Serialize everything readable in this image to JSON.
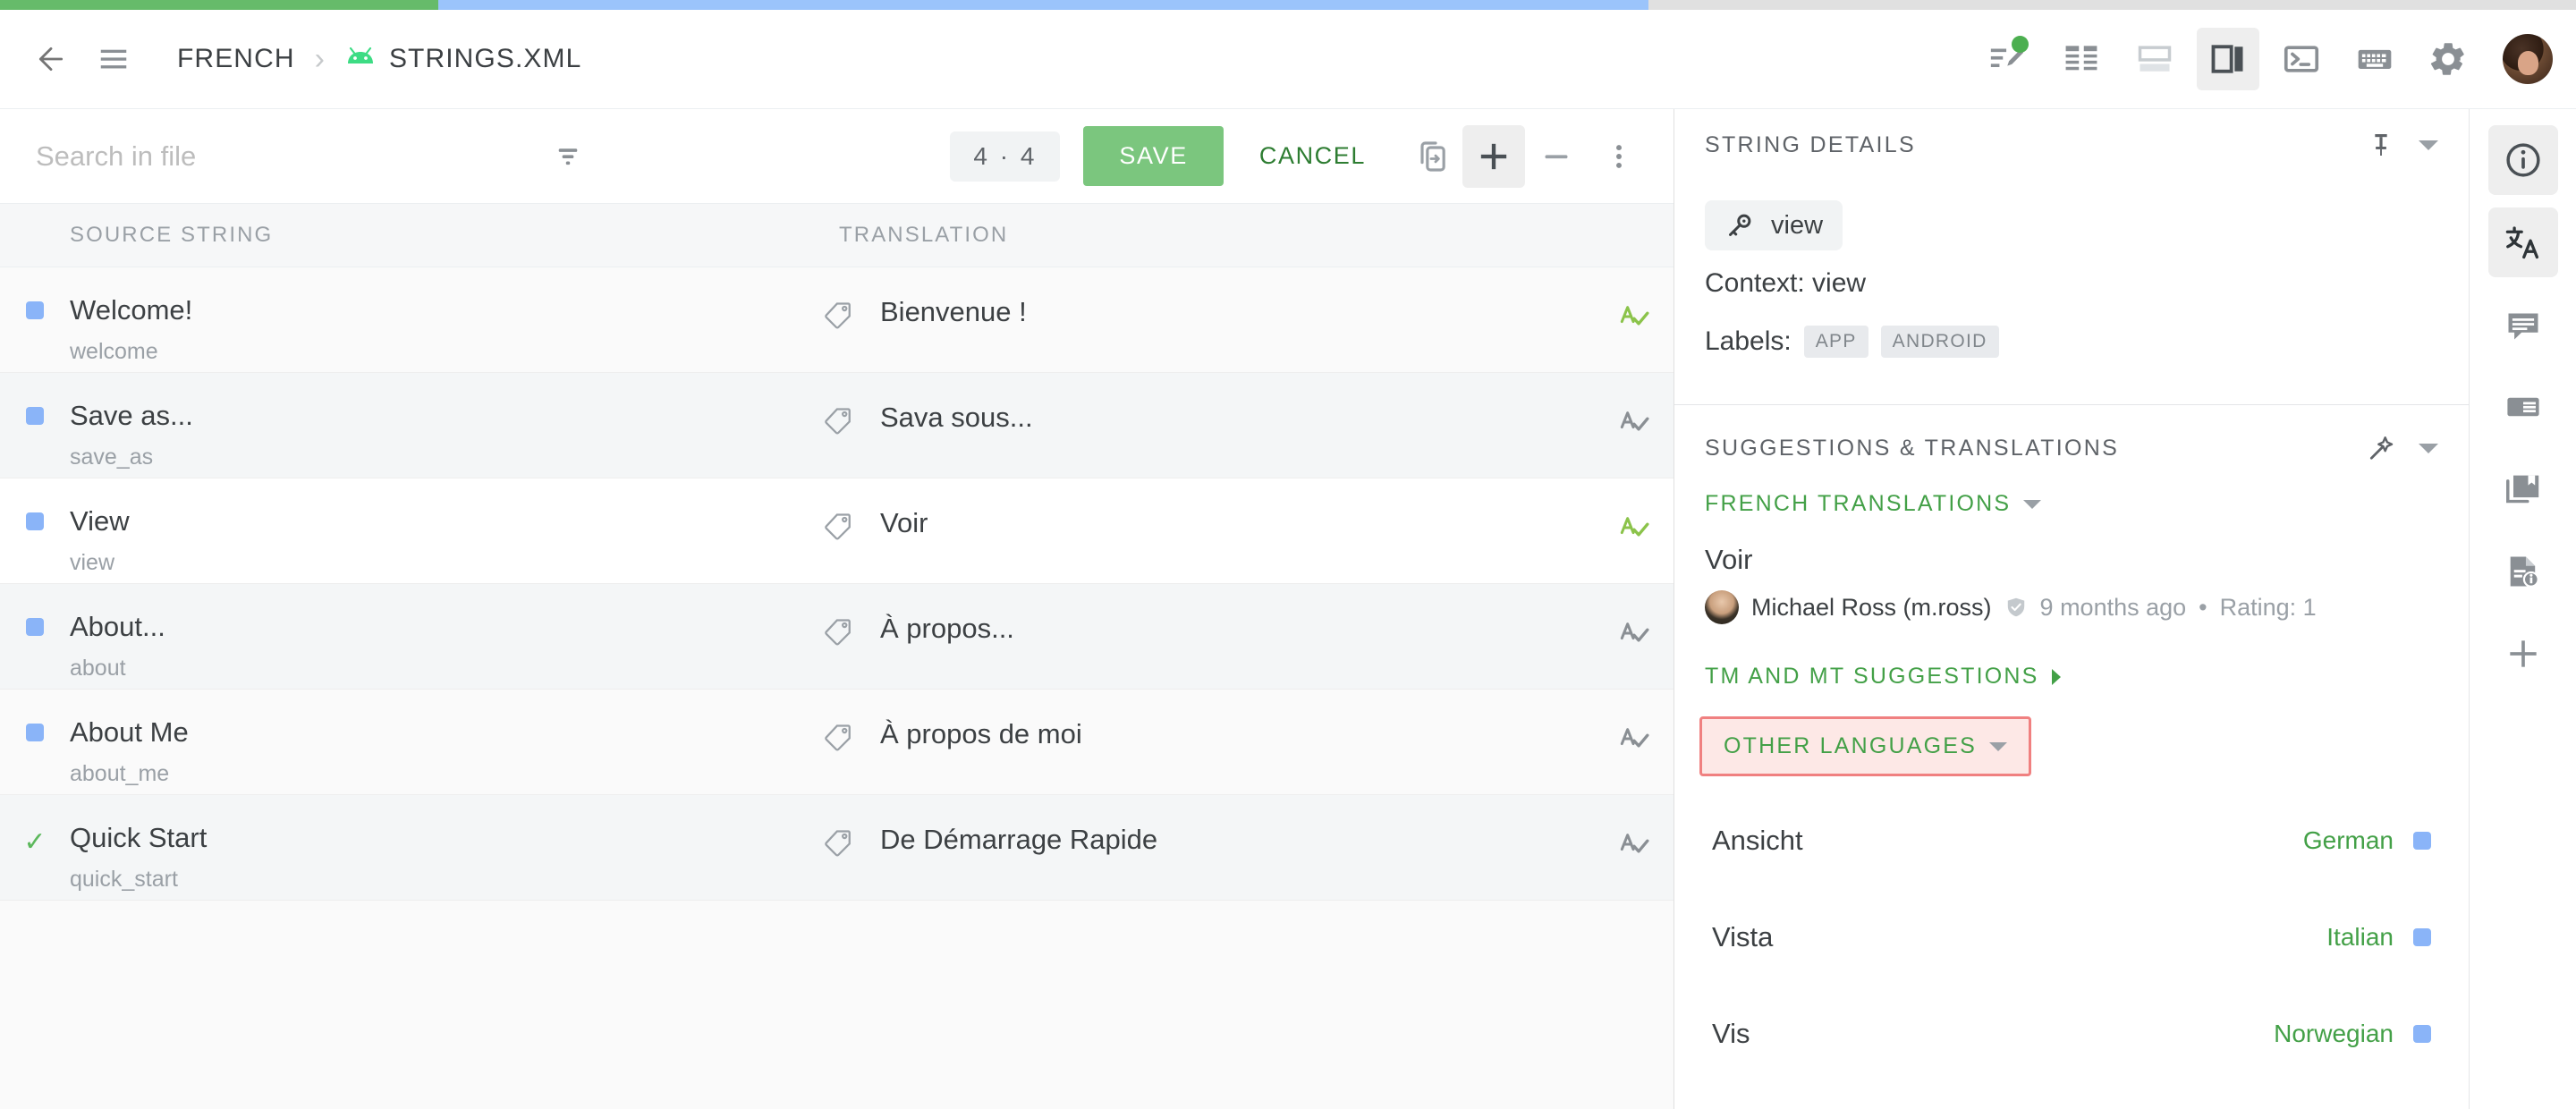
{
  "progress": {
    "segments": [
      {
        "name": "translated",
        "color": "#66bb6a",
        "percent": 17
      },
      {
        "name": "untranslated",
        "color": "#9bc4fb",
        "percent": 47
      },
      {
        "name": "remaining",
        "color": "#e0e0e0",
        "percent": 36
      }
    ]
  },
  "header": {
    "back_label": "←",
    "menu_label": "☰",
    "breadcrumb": [
      {
        "label": "FRENCH",
        "icon": ""
      },
      {
        "label": "STRINGS.XML",
        "icon": "android-icon"
      }
    ],
    "separator": "›",
    "tools": [
      {
        "name": "edit-mode-icon",
        "badge": true
      },
      {
        "name": "table-layout-icon",
        "badge": false
      },
      {
        "name": "horizontal-split-icon",
        "badge": false
      },
      {
        "name": "vertical-split-icon",
        "badge": false,
        "active": true
      },
      {
        "name": "terminal-icon",
        "badge": false
      },
      {
        "name": "keyboard-icon",
        "badge": false
      },
      {
        "name": "settings-gear-icon",
        "badge": false
      }
    ]
  },
  "editor": {
    "search": {
      "value": "",
      "placeholder": "Search in file"
    },
    "filter_icon": "filter-icon",
    "counter": "4 · 4",
    "save_label": "SAVE",
    "cancel_label": "CANCEL",
    "copy_icon": "copy-to-icon",
    "plus_icon": "plus-icon",
    "minus_icon": "minus-icon",
    "more_icon": "more-vertical-icon",
    "columns": {
      "source": "SOURCE STRING",
      "translation": "TRANSLATION"
    },
    "rows": [
      {
        "status": "square",
        "source": "Welcome!",
        "key": "welcome",
        "translation": "Bienvenue !",
        "spell_ok": true
      },
      {
        "status": "square",
        "source": "Save as...",
        "key": "save_as",
        "translation": "Sava sous...",
        "spell_ok": false
      },
      {
        "status": "square",
        "source": "View",
        "key": "view",
        "translation": "Voir",
        "spell_ok": true,
        "selected": true
      },
      {
        "status": "square",
        "source": "About...",
        "key": "about",
        "translation": "À propos...",
        "spell_ok": false
      },
      {
        "status": "square",
        "source": "About Me",
        "key": "about_me",
        "translation": "À propos de moi",
        "spell_ok": false
      },
      {
        "status": "check",
        "source": "Quick Start",
        "key": "quick_start",
        "translation": "De Démarrage Rapide",
        "spell_ok": false
      }
    ]
  },
  "details": {
    "title": "STRING DETAILS",
    "pin_icon": "pin-icon",
    "collapse_icon": "chevron-down-icon",
    "key_icon": "key-icon",
    "key": "view",
    "context": "Context: view",
    "labels_word": "Labels:",
    "labels": [
      "APP",
      "ANDROID"
    ]
  },
  "suggestions": {
    "title": "SUGGESTIONS & TRANSLATIONS",
    "magic_icon": "auto-fix-icon",
    "collapse_icon": "chevron-down-icon",
    "groups": {
      "french": {
        "label": "FRENCH TRANSLATIONS"
      },
      "tm_mt": {
        "label": "TM AND MT SUGGESTIONS"
      },
      "other": {
        "label": "OTHER LANGUAGES",
        "highlighted": true,
        "highlight_color": "#f08080"
      }
    },
    "translation": {
      "text": "Voir",
      "author": "Michael Ross (m.ross)",
      "verified_icon": "verified-shield-icon",
      "time": "9 months ago",
      "separator": "•",
      "rating": "Rating: 1"
    },
    "other_languages": [
      {
        "text": "Ansicht",
        "language": "German"
      },
      {
        "text": "Vista",
        "language": "Italian"
      },
      {
        "text": "Vis",
        "language": "Norwegian"
      }
    ]
  },
  "rail": [
    {
      "name": "info-icon",
      "active": true
    },
    {
      "name": "translate-icon",
      "active": true
    },
    {
      "name": "comment-icon",
      "active": false
    },
    {
      "name": "article-icon",
      "active": false
    },
    {
      "name": "glossary-icon",
      "active": false
    },
    {
      "name": "file-info-icon",
      "active": false
    },
    {
      "name": "add-icon",
      "active": false
    }
  ]
}
